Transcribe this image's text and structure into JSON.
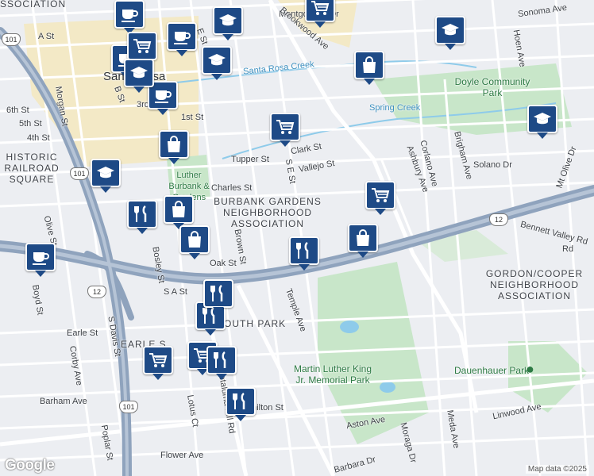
{
  "map": {
    "colors": {
      "background": "#eceef2",
      "road": "#ffffff",
      "highway": "#8fa3bd",
      "park": "#c8e6c9",
      "downtown": "#f3e9c6",
      "water": "#8ecbea",
      "marker": "#1e4a86"
    },
    "areas": [
      {
        "name": "top-left-association",
        "text": "SSOCIATION"
      },
      {
        "name": "historic-railroad-square",
        "text": "HISTORIC RAILROAD SQUARE"
      },
      {
        "name": "burbank-gardens",
        "text": "BURBANK GARDENS NEIGHBORHOOD ASSOCIATION"
      },
      {
        "name": "gordon-cooper",
        "text": "GORDON/COOPER NEIGHBORHOOD ASSOCIATION"
      },
      {
        "name": "south-park",
        "text": "OUTH PARK"
      },
      {
        "name": "earle-area",
        "text": "EARLE S"
      }
    ],
    "parks": [
      {
        "name": "doyle-park",
        "text": "Doyle Community Park"
      },
      {
        "name": "mlk-park",
        "text": "Martin Luther King Jr. Memorial Park"
      },
      {
        "name": "dauenhauer-park",
        "text": "Dauenhauer Park"
      },
      {
        "name": "luther-burbank-gardens",
        "text": "Luther Burbank & Gardens"
      }
    ],
    "city": "Santa Rosa",
    "waterways": [
      "Santa Rosa Creek",
      "Spring Creek"
    ],
    "streets": [
      "Montgomery Dr",
      "Sonoma Ave",
      "Brookwood Ave",
      "Hoen Ave",
      "Morgan St",
      "6th St",
      "5th St",
      "4th St",
      "3rd St",
      "1st St",
      "A St",
      "B St",
      "E St",
      "Tupper St",
      "Clark St",
      "Vallejo St",
      "S E St",
      "Charles St",
      "Ashbury Ave",
      "Corlano Ave",
      "Brigham Ave",
      "Solano Dr",
      "Mt Olive Dr",
      "Bennett Valley Rd",
      "Olive St",
      "Bosley St",
      "Brown St",
      "Oak St",
      "S A St",
      "Boyd St",
      "Temple Ave",
      "Earle St",
      "Corby Ave",
      "S Davis St",
      "Barham Ave",
      "Lotus Ct",
      "Petaluma Hill Rd",
      "Hamilton St",
      "Aston Ave",
      "Linwood Ave",
      "Meda Ave",
      "Poplar St",
      "Flower Ave",
      "Moraga Dr",
      "Barbara Dr",
      "Hoen Ave",
      "Rd"
    ],
    "highway_shields": [
      "101",
      "101",
      "12",
      "12",
      "101"
    ],
    "markers": [
      {
        "type": "coffee"
      },
      {
        "type": "coffee"
      },
      {
        "type": "coffee"
      },
      {
        "type": "coffee"
      },
      {
        "type": "coffee"
      },
      {
        "type": "grocery"
      },
      {
        "type": "grocery"
      },
      {
        "type": "grocery"
      },
      {
        "type": "grocery"
      },
      {
        "type": "grocery"
      },
      {
        "type": "grocery"
      },
      {
        "type": "school"
      },
      {
        "type": "school"
      },
      {
        "type": "school"
      },
      {
        "type": "school"
      },
      {
        "type": "school"
      },
      {
        "type": "school"
      },
      {
        "type": "shopping"
      },
      {
        "type": "shopping"
      },
      {
        "type": "shopping"
      },
      {
        "type": "shopping"
      },
      {
        "type": "shopping"
      },
      {
        "type": "restaurant"
      },
      {
        "type": "restaurant"
      },
      {
        "type": "restaurant"
      },
      {
        "type": "restaurant"
      },
      {
        "type": "restaurant"
      },
      {
        "type": "restaurant"
      }
    ],
    "attribution": "Map data ©2025",
    "logo": "Google"
  }
}
